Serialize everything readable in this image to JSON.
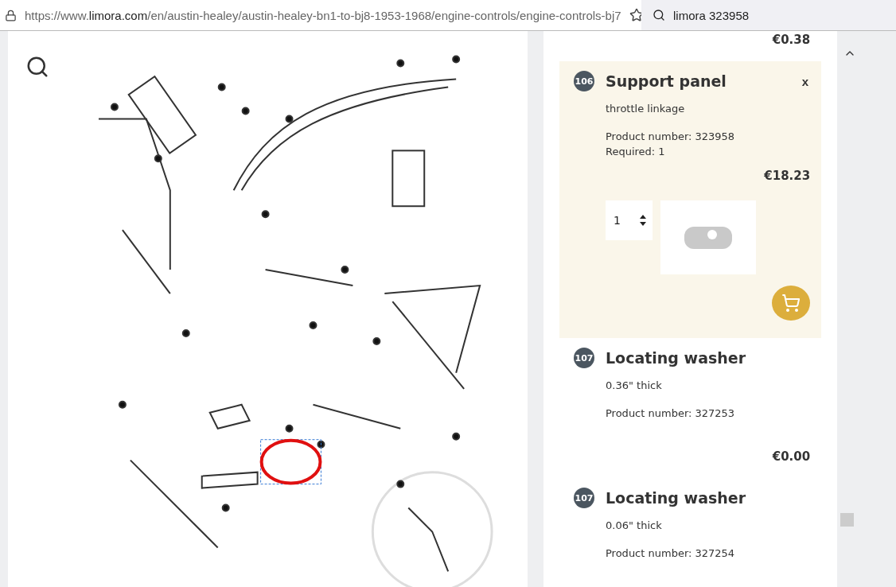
{
  "browser": {
    "url_prefix": "https://www.",
    "url_domain": "limora.com",
    "url_path": "/en/austin-healey/austin-healey-bn1-to-bj8-1953-1968/engine-controls/engine-controls-bj7",
    "search": "limora 323958"
  },
  "diagram": {
    "highlighted": true
  },
  "parts": [
    {
      "price": "€0.38",
      "selected": false
    },
    {
      "number": "106",
      "title": "Support panel",
      "description": "throttle linkage",
      "product_number": "Product number: 323958",
      "required": "Required: 1",
      "price": "€18.23",
      "selected": true,
      "quantity": "1",
      "close": "x"
    },
    {
      "number": "107",
      "title": "Locating washer",
      "description": "0.36\" thick",
      "product_number": "Product number: 327253",
      "price": "€0.00",
      "selected": false
    },
    {
      "number": "107",
      "title": "Locating washer",
      "description": "0.06\" thick",
      "product_number": "Product number: 327254",
      "selected": false
    }
  ]
}
